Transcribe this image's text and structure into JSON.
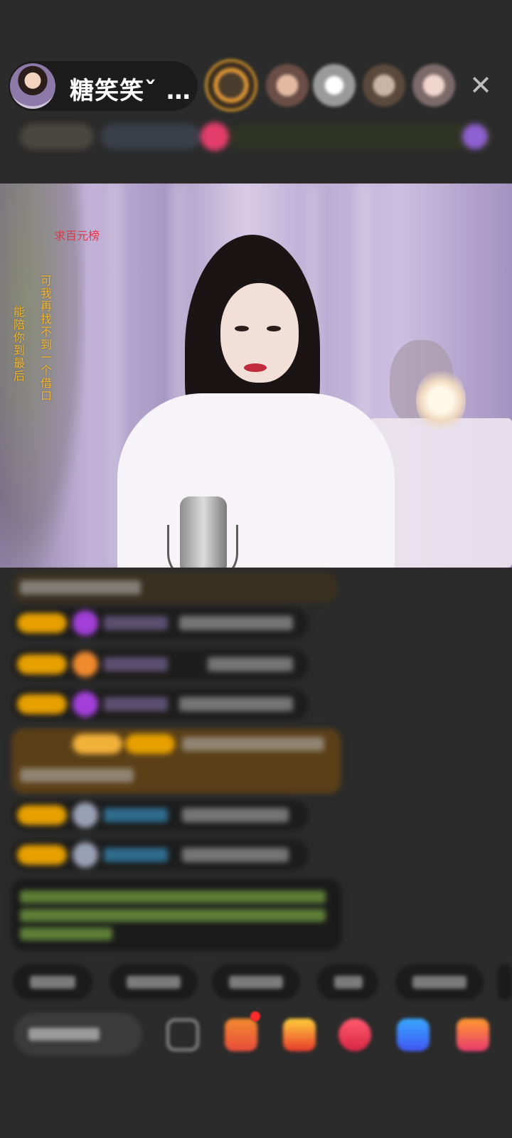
{
  "header": {
    "host_name": "糖笑笑ˇ …"
  },
  "video": {
    "overlay_red": "求百元榜",
    "vertical_text_1": "可我再找不到一个借口",
    "vertical_text_2": "能陪你到最后"
  },
  "icons": {
    "close": "close-icon",
    "emoji": "emoji-icon",
    "gift_box": "gift-box-icon",
    "gift": "gift-icon",
    "heart": "heart-icon",
    "game": "game-icon",
    "more": "more-icon"
  },
  "colors": {
    "background": "#2b2b2b",
    "accent_gold": "#e6a000",
    "overlay_orange": "#f2b531",
    "overlay_red": "#e0384a"
  }
}
